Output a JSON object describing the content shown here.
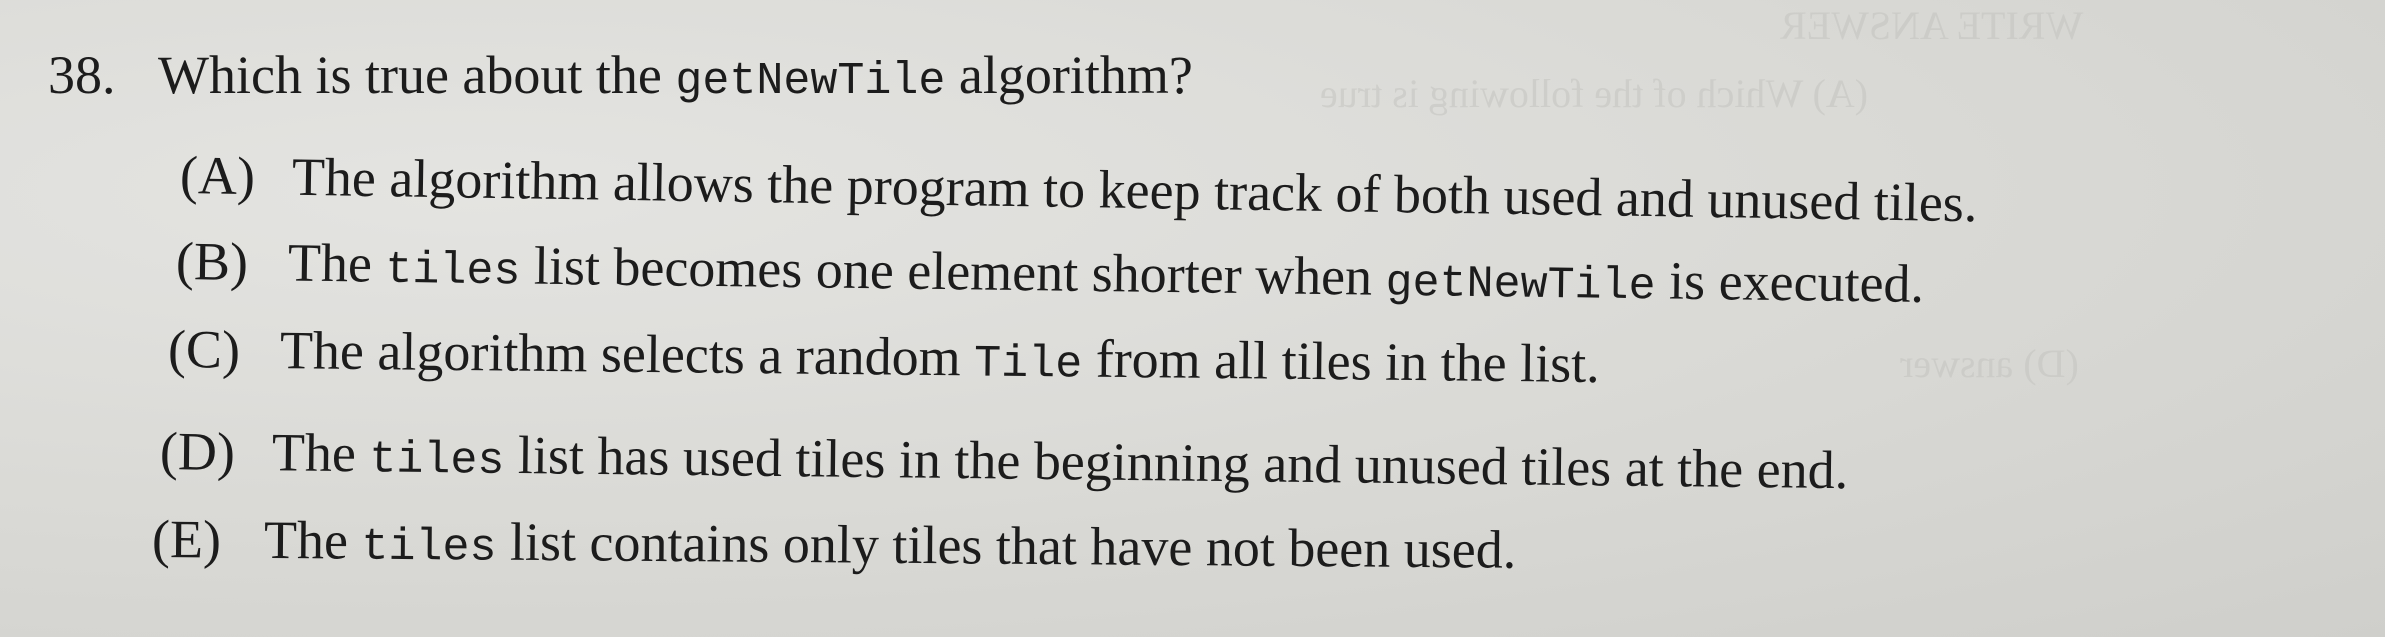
{
  "question": {
    "number": "38.",
    "text_before": "Which is true about the ",
    "code": "getNewTile",
    "text_after": " algorithm?"
  },
  "choices": [
    {
      "letter": "(A)",
      "parts": [
        "The algorithm allows the program to keep track of both used and unused tiles."
      ]
    },
    {
      "letter": "(B)",
      "parts": [
        "The ",
        "tiles",
        " list becomes one element shorter when ",
        "getNewTile",
        " is executed."
      ]
    },
    {
      "letter": "(C)",
      "parts": [
        "The algorithm selects a random ",
        "Tile",
        " from all tiles in the list."
      ]
    },
    {
      "letter": "(D)",
      "parts": [
        "The ",
        "tiles",
        " list has used tiles in the beginning and unused tiles at the end."
      ]
    },
    {
      "letter": "(E)",
      "parts": [
        "The ",
        "tiles",
        " list contains only tiles that have not been used."
      ]
    }
  ]
}
